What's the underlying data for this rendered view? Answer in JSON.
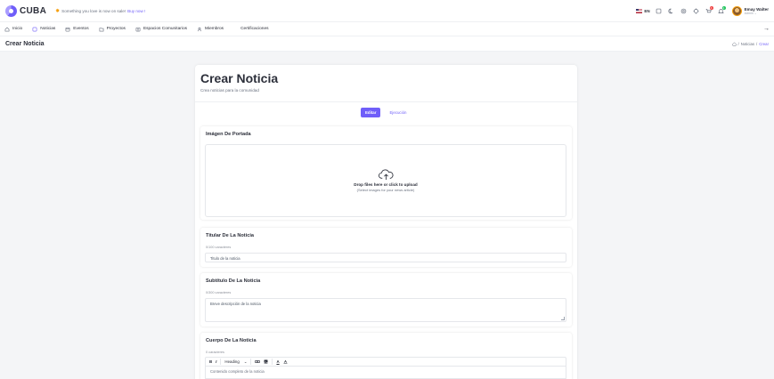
{
  "brand": {
    "name": "CUBA"
  },
  "promo": {
    "text": "Something you love is now on sale!",
    "link": "Buy now !"
  },
  "header": {
    "language": "EN",
    "user": {
      "name": "Emay Walter",
      "role": "Admin ⌄"
    },
    "badges": {
      "cart": "3",
      "notifications": "4"
    }
  },
  "nav": {
    "items": [
      {
        "label": "Inicio",
        "icon": "home-icon"
      },
      {
        "label": "Noticias",
        "icon": "news-icon"
      },
      {
        "label": "Eventos",
        "icon": "calendar-icon"
      },
      {
        "label": "Proyectos",
        "icon": "folder-icon"
      },
      {
        "label": "Espacios Comunitarios",
        "icon": "building-icon"
      },
      {
        "label": "Miembros",
        "icon": "users-icon"
      },
      {
        "label": "Certificaciones",
        "icon": ""
      }
    ],
    "collapse": "→"
  },
  "page": {
    "title": "Crear Noticia",
    "breadcrumb": {
      "sep1": "/",
      "section": "Noticias",
      "sep2": "/",
      "current": "Crear"
    }
  },
  "form": {
    "title": "Crear Noticia",
    "subtitle": "Crea noticias para la comunidad",
    "tabs": {
      "edit": "Editar",
      "preview": "Ejecución"
    },
    "cover": {
      "title": "Imágen De Portada",
      "drop_title": "Drop files here or click to upload",
      "drop_sub": "(Select images for your news article)"
    },
    "headline": {
      "title": "Titular De La Noticia",
      "counter": "0/100 caracteres",
      "placeholder": "Titulo de la noticia"
    },
    "subtitle_field": {
      "title": "Subtítulo De La Noticia",
      "counter": "0/300 caracteres",
      "placeholder": "Breve descripción de la noticia"
    },
    "body": {
      "title": "Cuerpo De La Noticia",
      "counter": "0 caracteres",
      "toolbar": {
        "bold": "B",
        "italic": "I",
        "heading": "Heading",
        "chevron": "⌄",
        "font_color": "A"
      },
      "placeholder": "Contenido completo de la noticia"
    }
  },
  "colors": {
    "accent": "#6f5ef9",
    "background": "#f4f5f7",
    "text": "#2c2f3a"
  }
}
